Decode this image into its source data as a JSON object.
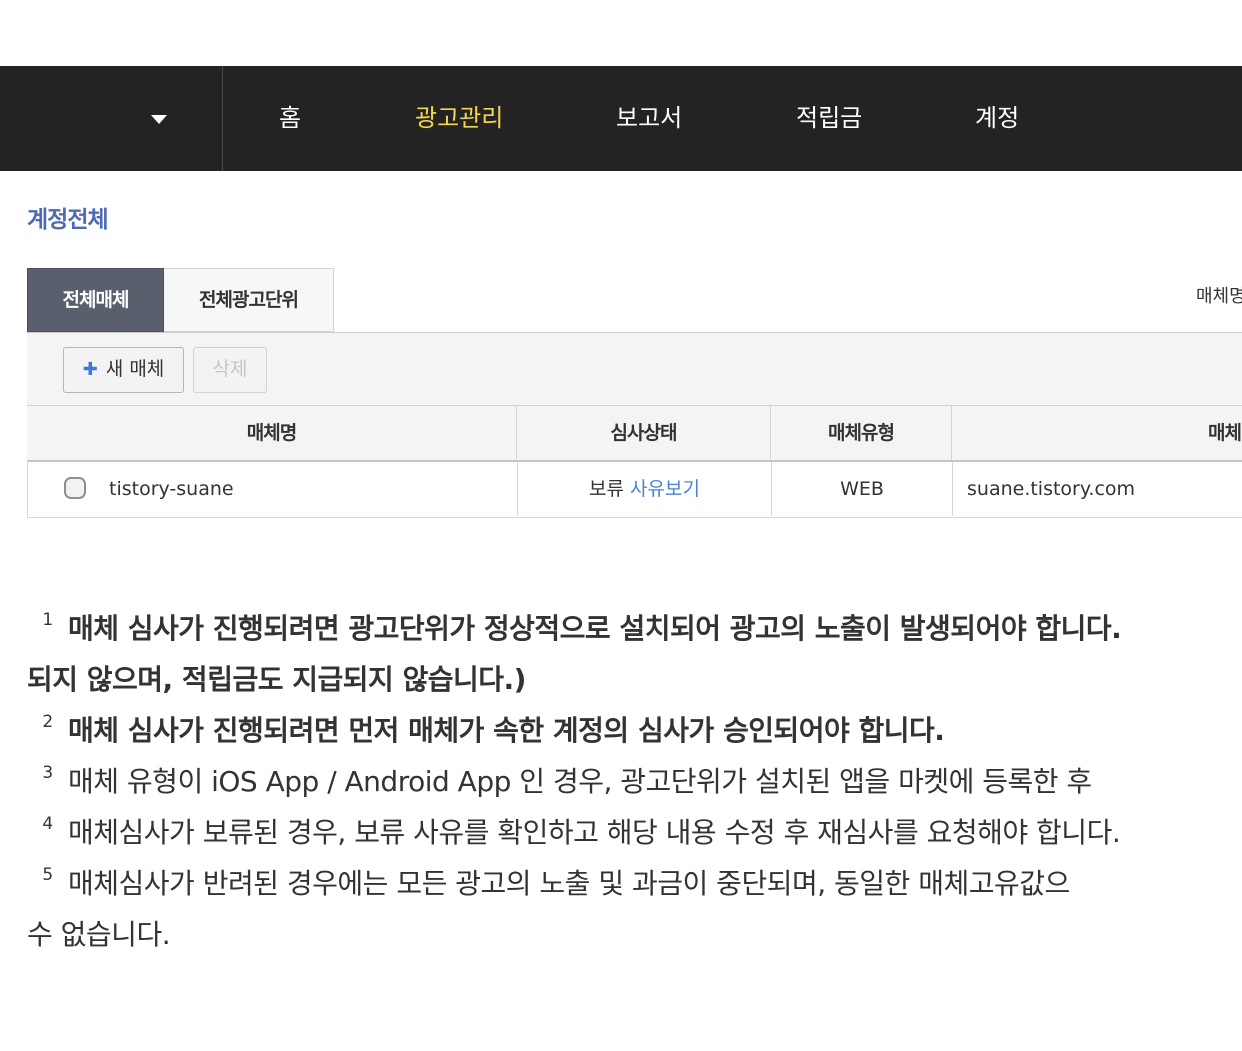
{
  "nav": {
    "items": [
      {
        "label": "홈",
        "active": false
      },
      {
        "label": "광고관리",
        "active": true
      },
      {
        "label": "보고서",
        "active": false
      },
      {
        "label": "적립금",
        "active": false
      },
      {
        "label": "계정",
        "active": false
      }
    ],
    "active_color": "#f3d54e",
    "background": "#232323"
  },
  "account": {
    "title": "계정전체"
  },
  "tabs": [
    {
      "label": "전체매체",
      "active": true
    },
    {
      "label": "전체광고단위",
      "active": false
    }
  ],
  "top_right": {
    "label": "매체명"
  },
  "toolbar": {
    "new_icon": "plus-icon",
    "new_label": "새 매체",
    "delete_label": "삭제"
  },
  "table": {
    "headers": [
      "매체명",
      "심사상태",
      "매체유형",
      "매체URL"
    ],
    "rows": [
      {
        "name": "tistory-suane",
        "status": "보류",
        "status_link": "사유보기",
        "type": "WEB",
        "url": "suane.tistory.com"
      }
    ]
  },
  "notes": [
    {
      "num": "1",
      "lines": [
        "매체 심사가 진행되려면 광고단위가 정상적으로 설치되어 광고의 노출이 발생되어야 합니다.",
        "되지 않으며, 적립금도 지급되지 않습니다.)"
      ]
    },
    {
      "num": "2",
      "lines": [
        "매체 심사가 진행되려면 먼저 매체가 속한 계정의 심사가 승인되어야 합니다."
      ]
    },
    {
      "num": "3",
      "lines": [
        "매체 유형이 iOS App / Android App 인 경우, 광고단위가 설치된 앱을 마켓에 등록한 후"
      ]
    },
    {
      "num": "4",
      "lines": [
        "매체심사가 보류된 경우, 보류 사유를 확인하고 해당 내용 수정 후 재심사를 요청해야 합니다."
      ]
    },
    {
      "num": "5",
      "lines": [
        "매체심사가 반려된 경우에는 모든 광고의 노출 및 과금이 중단되며, 동일한 매체고유값으",
        "수 없습니다."
      ]
    }
  ]
}
